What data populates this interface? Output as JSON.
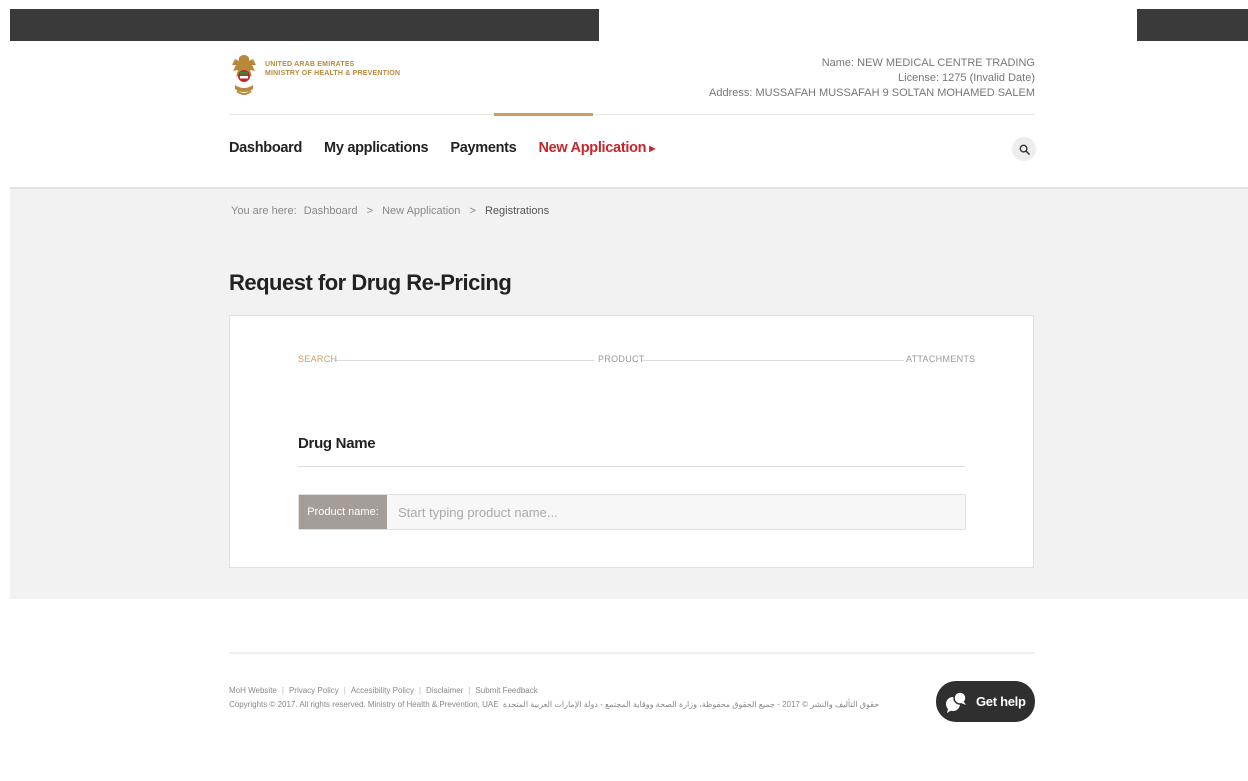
{
  "header": {
    "logo_line1": "UNITED ARAB EMIRATES",
    "logo_line2": "MINISTRY OF HEALTH & PREVENTION",
    "account_name": "Name: NEW MEDICAL CENTRE TRADING",
    "account_license": "License: 1275 (Invalid Date)",
    "account_address": "Address: MUSSAFAH MUSSAFAH 9 SOLTAN MOHAMED SALEM"
  },
  "nav": {
    "items": [
      {
        "label": "Dashboard"
      },
      {
        "label": "My applications"
      },
      {
        "label": "Payments"
      },
      {
        "label": "New Application"
      }
    ],
    "active_index": 3
  },
  "breadcrumb": {
    "prefix": "You are here:",
    "items": [
      "Dashboard",
      "New Application",
      "Registrations"
    ],
    "separator": ">"
  },
  "page": {
    "title": "Request for Drug Re-Pricing"
  },
  "wizard": {
    "steps": [
      "SEARCH",
      "PRODUCT",
      "ATTACHMENTS"
    ],
    "active_step": 0
  },
  "form": {
    "section_title": "Drug Name",
    "product_label": "Product name:",
    "product_placeholder": "Start typing product name...",
    "product_value": ""
  },
  "footer": {
    "links": [
      "MoH Website",
      "Privacy Policy",
      "Accesibility Policy",
      "Disclaimer",
      "Submit Feedback"
    ],
    "copyright": "Copyrights © 2017. All rights reserved. Ministry of Health & Prevention, UAE",
    "copyright_ar": "حقوق التأليف والنشر © 2017 - جميع الحقوق محفوظة، وزارة الصحة ووقاية المجتمع - دولة الإمارات العربية المتحدة"
  },
  "help": {
    "label": "Get help"
  },
  "colors": {
    "accent_gold": "#c9a063",
    "active_red": "#c4262e",
    "band_gray": "#f2f2f2",
    "dark": "#2f2f2f"
  },
  "icons": {
    "logo": "uae-emblem-icon",
    "search": "search-icon",
    "nav_arrow": "caret-right-icon",
    "help": "chat-bubble-icon"
  }
}
